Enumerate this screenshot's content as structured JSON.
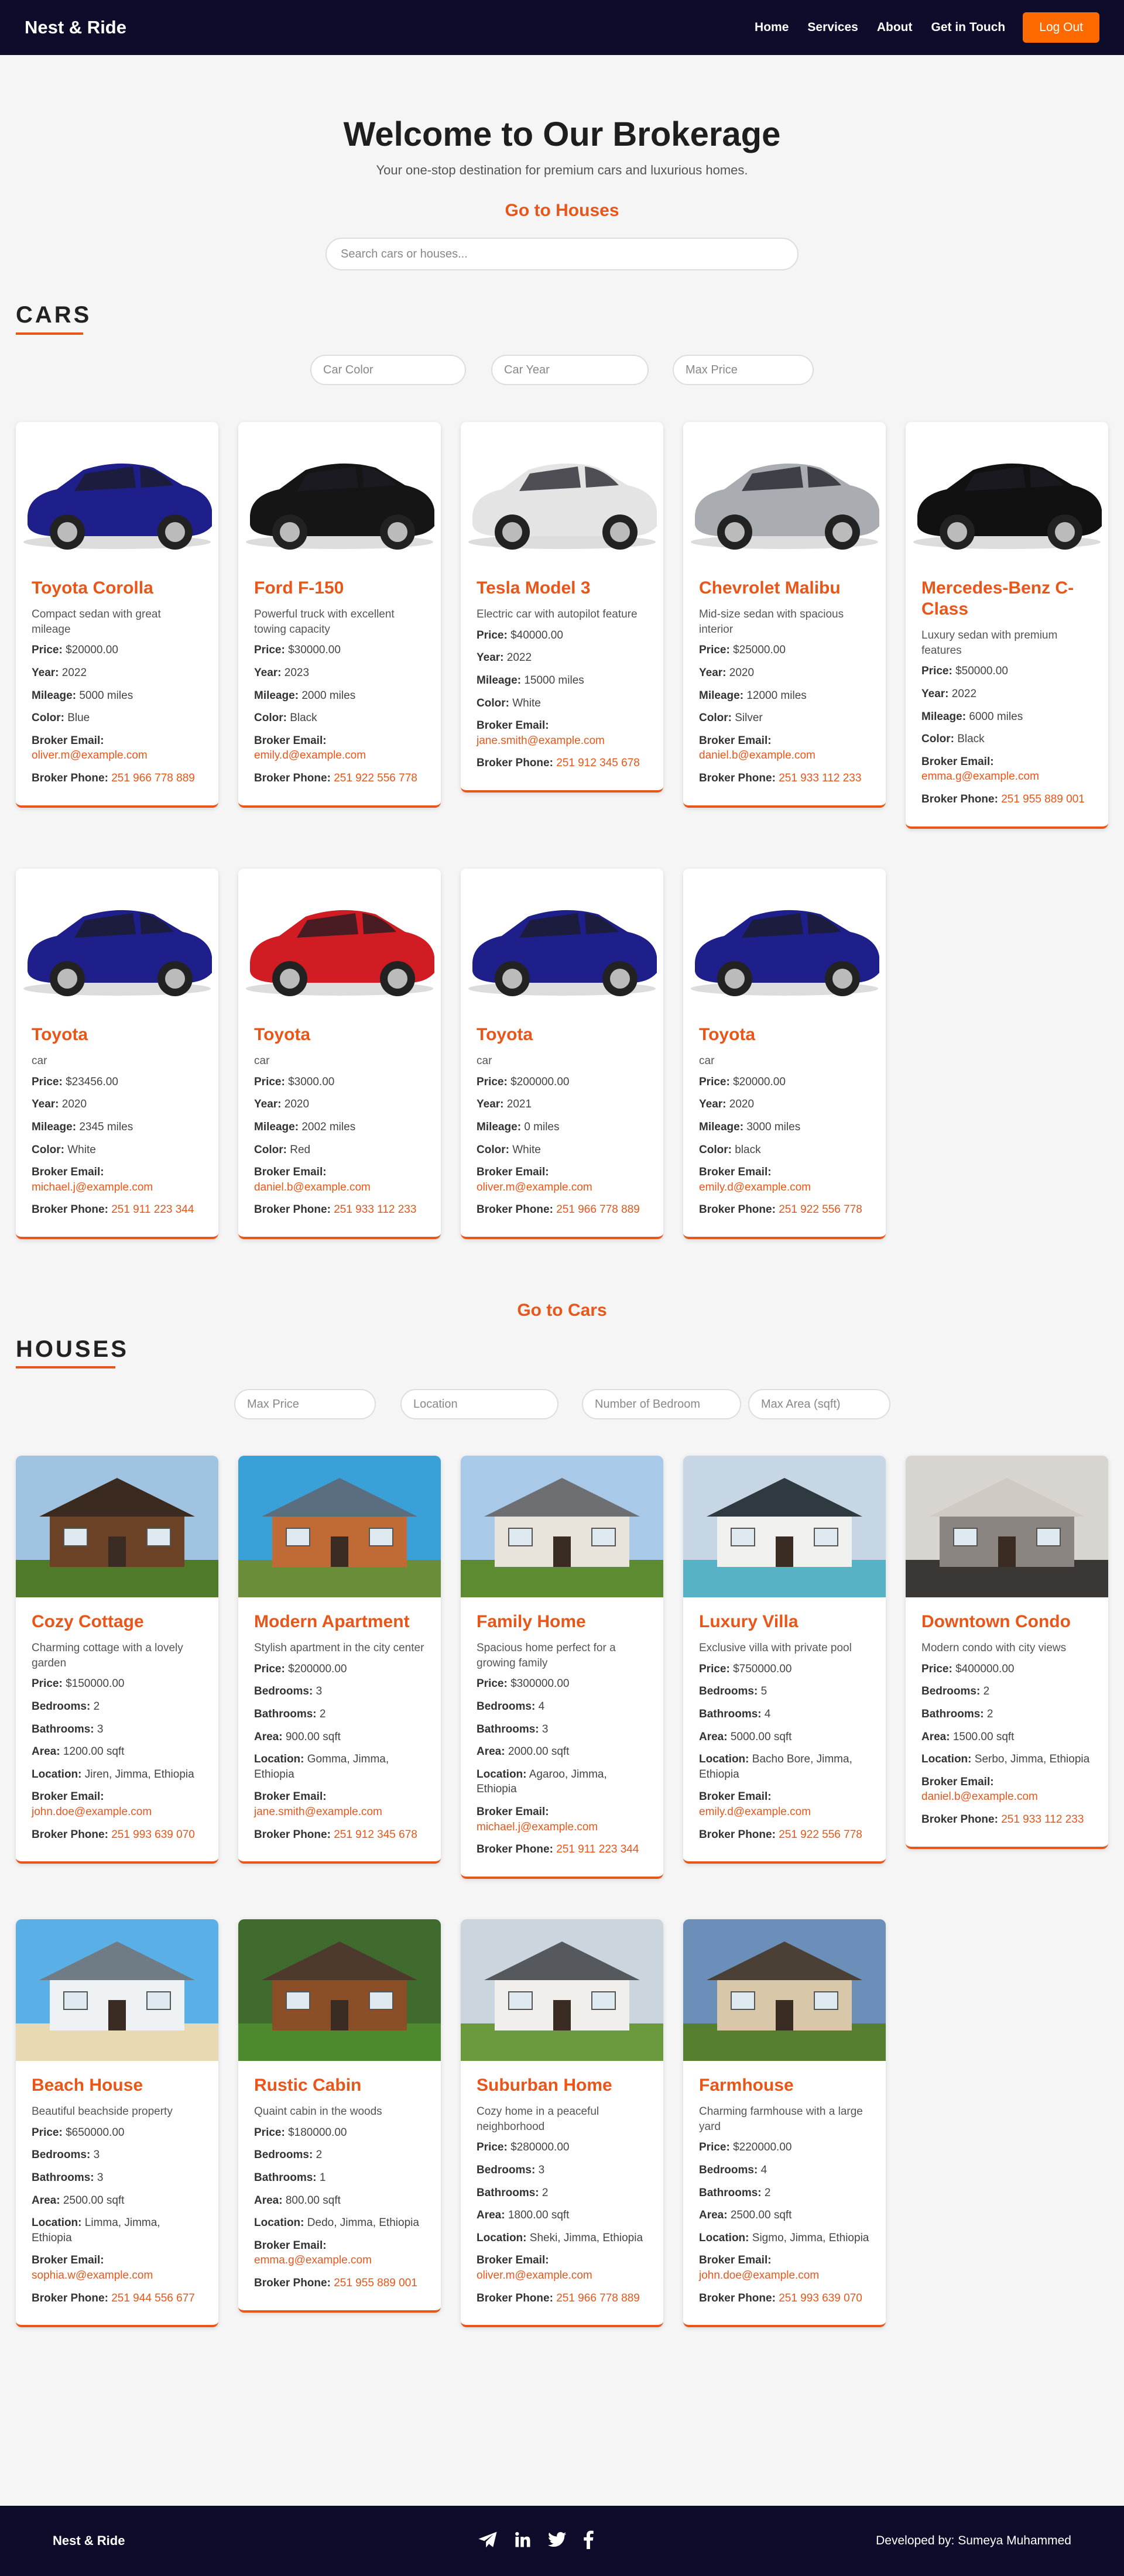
{
  "nav": {
    "brand": "Nest & Ride",
    "links": [
      "Home",
      "Services",
      "About",
      "Get in Touch"
    ],
    "logout": "Log Out"
  },
  "hero": {
    "title": "Welcome to Our Brokerage",
    "subtitle": "Your one-stop destination for premium cars and luxurious homes.",
    "goto_houses": "Go to Houses",
    "search_placeholder": "Search cars or houses..."
  },
  "cars_section": {
    "title": "CARS",
    "filters": [
      "Car Color",
      "Car Year",
      "Max Price"
    ],
    "labels": {
      "price": "Price:",
      "year": "Year:",
      "mileage": "Mileage:",
      "color": "Color:",
      "email": "Broker Email:",
      "phone": "Broker Phone:"
    },
    "cars": [
      {
        "name": "Toyota Corolla",
        "desc": "Compact sedan with great mileage",
        "price": "$20000.00",
        "year": "2022",
        "mileage": "5000 miles",
        "color": "Blue",
        "email": "oliver.m@example.com",
        "phone": "251 966 778 889",
        "car_color": "#1e1f8a"
      },
      {
        "name": "Ford F-150",
        "desc": "Powerful truck with excellent towing capacity",
        "price": "$30000.00",
        "year": "2023",
        "mileage": "2000 miles",
        "color": "Black",
        "email": "emily.d@example.com",
        "phone": "251 922 556 778",
        "car_color": "#151515"
      },
      {
        "name": "Tesla Model 3",
        "desc": "Electric car with autopilot feature",
        "price": "$40000.00",
        "year": "2022",
        "mileage": "15000 miles",
        "color": "White",
        "email": "jane.smith@example.com",
        "phone": "251 912 345 678",
        "car_color": "#e4e4e4"
      },
      {
        "name": "Chevrolet Malibu",
        "desc": "Mid-size sedan with spacious interior",
        "price": "$25000.00",
        "year": "2020",
        "mileage": "12000 miles",
        "color": "Silver",
        "email": "daniel.b@example.com",
        "phone": "251 933 112 233",
        "car_color": "#a9acb1"
      },
      {
        "name": "Mercedes-Benz C-Class",
        "desc": "Luxury sedan with premium features",
        "price": "$50000.00",
        "year": "2022",
        "mileage": "6000 miles",
        "color": "Black",
        "email": "emma.g@example.com",
        "phone": "251 955 889 001",
        "car_color": "#111111"
      },
      {
        "name": "Toyota",
        "desc": "car",
        "price": "$23456.00",
        "year": "2020",
        "mileage": "2345 miles",
        "color": "White",
        "email": "michael.j@example.com",
        "phone": "251 911 223 344",
        "car_color": "#1e1f8a"
      },
      {
        "name": "Toyota",
        "desc": "car",
        "price": "$3000.00",
        "year": "2020",
        "mileage": "2002 miles",
        "color": "Red",
        "email": "daniel.b@example.com",
        "phone": "251 933 112 233",
        "car_color": "#d01c22"
      },
      {
        "name": "Toyota",
        "desc": "car",
        "price": "$200000.00",
        "year": "2021",
        "mileage": "0 miles",
        "color": "White",
        "email": "oliver.m@example.com",
        "phone": "251 966 778 889",
        "car_color": "#1e1f8a"
      },
      {
        "name": "Toyota",
        "desc": "car",
        "price": "$20000.00",
        "year": "2020",
        "mileage": "3000 miles",
        "color": "black",
        "email": "emily.d@example.com",
        "phone": "251 922 556 778",
        "car_color": "#1e1f8a"
      }
    ]
  },
  "goto_cars": "Go to Cars",
  "houses_section": {
    "title": "HOUSES",
    "filters": [
      "Max Price",
      "Location",
      "Number of Bedroom",
      "Max Area (sqft)"
    ],
    "labels": {
      "price": "Price:",
      "bedrooms": "Bedrooms:",
      "bathrooms": "Bathrooms:",
      "area": "Area:",
      "location": "Location:",
      "email": "Broker Email:",
      "phone": "Broker Phone:"
    },
    "houses": [
      {
        "name": "Cozy Cottage",
        "desc": "Charming cottage with a lovely garden",
        "price": "$150000.00",
        "bedrooms": "2",
        "bathrooms": "3",
        "area": "1200.00 sqft",
        "location": "Jiren, Jimma, Ethiopia",
        "email": "john.doe@example.com",
        "phone": "251 993 639 070",
        "sky": "#9fc3e0",
        "wall": "#6b4226",
        "roof": "#3b2a20",
        "ground": "#4f7a2a"
      },
      {
        "name": "Modern Apartment",
        "desc": "Stylish apartment in the city center",
        "price": "$200000.00",
        "bedrooms": "3",
        "bathrooms": "2",
        "area": "900.00 sqft",
        "location": "Gomma, Jimma, Ethiopia",
        "email": "jane.smith@example.com",
        "phone": "251 912 345 678",
        "sky": "#3aa0d8",
        "wall": "#c06a35",
        "roof": "#5a6e80",
        "ground": "#6a8d3a"
      },
      {
        "name": "Family Home",
        "desc": "Spacious home perfect for a growing family",
        "price": "$300000.00",
        "bedrooms": "4",
        "bathrooms": "3",
        "area": "2000.00 sqft",
        "location": "Agaroo, Jimma, Ethiopia",
        "email": "michael.j@example.com",
        "phone": "251 911 223 344",
        "sky": "#a9c9e8",
        "wall": "#e8e4dc",
        "roof": "#6d6f73",
        "ground": "#5c8b31"
      },
      {
        "name": "Luxury Villa",
        "desc": "Exclusive villa with private pool",
        "price": "$750000.00",
        "bedrooms": "5",
        "bathrooms": "4",
        "area": "5000.00 sqft",
        "location": "Bacho Bore, Jimma, Ethiopia",
        "email": "emily.d@example.com",
        "phone": "251 922 556 778",
        "sky": "#c7d6e4",
        "wall": "#f0f0ee",
        "roof": "#2f3a40",
        "ground": "#57b2c6"
      },
      {
        "name": "Downtown Condo",
        "desc": "Modern condo with city views",
        "price": "$400000.00",
        "bedrooms": "2",
        "bathrooms": "2",
        "area": "1500.00 sqft",
        "location": "Serbo, Jimma, Ethiopia",
        "email": "daniel.b@example.com",
        "phone": "251 933 112 233",
        "sky": "#d8d4cf",
        "wall": "#8a8580",
        "roof": "#cfcac4",
        "ground": "#3a3734"
      },
      {
        "name": "Beach House",
        "desc": "Beautiful beachside property",
        "price": "$650000.00",
        "bedrooms": "3",
        "bathrooms": "3",
        "area": "2500.00 sqft",
        "location": "Limma, Jimma, Ethiopia",
        "email": "sophia.w@example.com",
        "phone": "251 944 556 677",
        "sky": "#5ab0e6",
        "wall": "#eef2f4",
        "roof": "#6f7c86",
        "ground": "#e9d9b3"
      },
      {
        "name": "Rustic Cabin",
        "desc": "Quaint cabin in the woods",
        "price": "$180000.00",
        "bedrooms": "2",
        "bathrooms": "1",
        "area": "800.00 sqft",
        "location": "Dedo, Jimma, Ethiopia",
        "email": "emma.g@example.com",
        "phone": "251 955 889 001",
        "sky": "#3f6b2e",
        "wall": "#8a4f26",
        "roof": "#4e3a2c",
        "ground": "#4d8a2d"
      },
      {
        "name": "Suburban Home",
        "desc": "Cozy home in a peaceful neighborhood",
        "price": "$280000.00",
        "bedrooms": "3",
        "bathrooms": "2",
        "area": "1800.00 sqft",
        "location": "Sheki, Jimma, Ethiopia",
        "email": "oliver.m@example.com",
        "phone": "251 966 778 889",
        "sky": "#cbd5de",
        "wall": "#f1efec",
        "roof": "#55595d",
        "ground": "#6a9a3d"
      },
      {
        "name": "Farmhouse",
        "desc": "Charming farmhouse with a large yard",
        "price": "$220000.00",
        "bedrooms": "4",
        "bathrooms": "2",
        "area": "2500.00 sqft",
        "location": "Sigmo, Jimma, Ethiopia",
        "email": "john.doe@example.com",
        "phone": "251 993 639 070",
        "sky": "#6b8fb8",
        "wall": "#d8c7a8",
        "roof": "#4b4035",
        "ground": "#557f2e"
      }
    ]
  },
  "footer": {
    "brand": "Nest & Ride",
    "icons": [
      "telegram-icon",
      "linkedin-icon",
      "twitter-icon",
      "facebook-icon"
    ],
    "developer": "Developed by: Sumeya Muhammed"
  },
  "colors": {
    "accent": "#e8561a",
    "button": "#ff6a00",
    "navy": "#0d0c2a",
    "background": "#f5f5f5"
  }
}
